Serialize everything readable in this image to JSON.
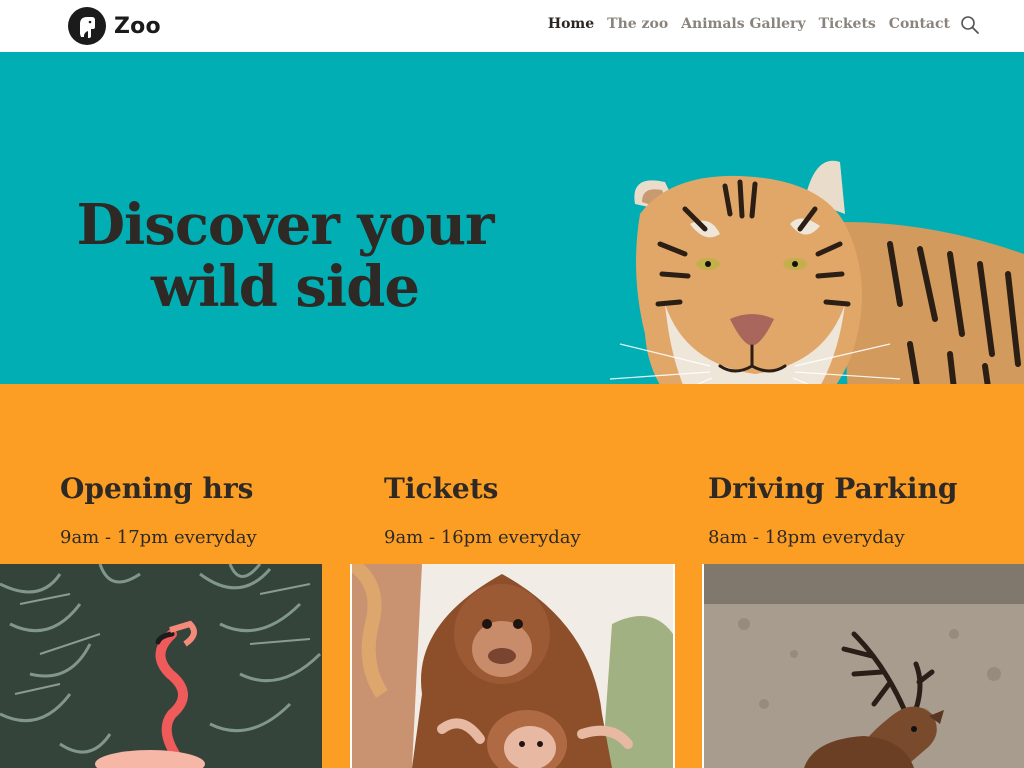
{
  "header": {
    "logo_text": "Zoo",
    "logo_icon": "elephant-head-icon",
    "nav": [
      {
        "label": "Home",
        "active": true
      },
      {
        "label": "The zoo",
        "active": false
      },
      {
        "label": "Animals Gallery",
        "active": false
      },
      {
        "label": "Tickets",
        "active": false
      },
      {
        "label": "Contact",
        "active": false
      }
    ],
    "search_icon": "search-icon"
  },
  "hero": {
    "title_line1": "Discover your",
    "title_line2": "wild side",
    "background_color": "#00aeb3"
  },
  "info": {
    "background_color": "#fb9e23",
    "columns": [
      {
        "title": "Opening hrs",
        "text": "9am - 17pm everyday"
      },
      {
        "title": "Tickets",
        "text": "9am - 16pm everyday"
      },
      {
        "title": "Driving Parking",
        "text": "8am - 18pm everyday"
      }
    ]
  },
  "photos": [
    {
      "subject": "flamingo"
    },
    {
      "subject": "monkey-with-baby"
    },
    {
      "subject": "deer"
    }
  ]
}
